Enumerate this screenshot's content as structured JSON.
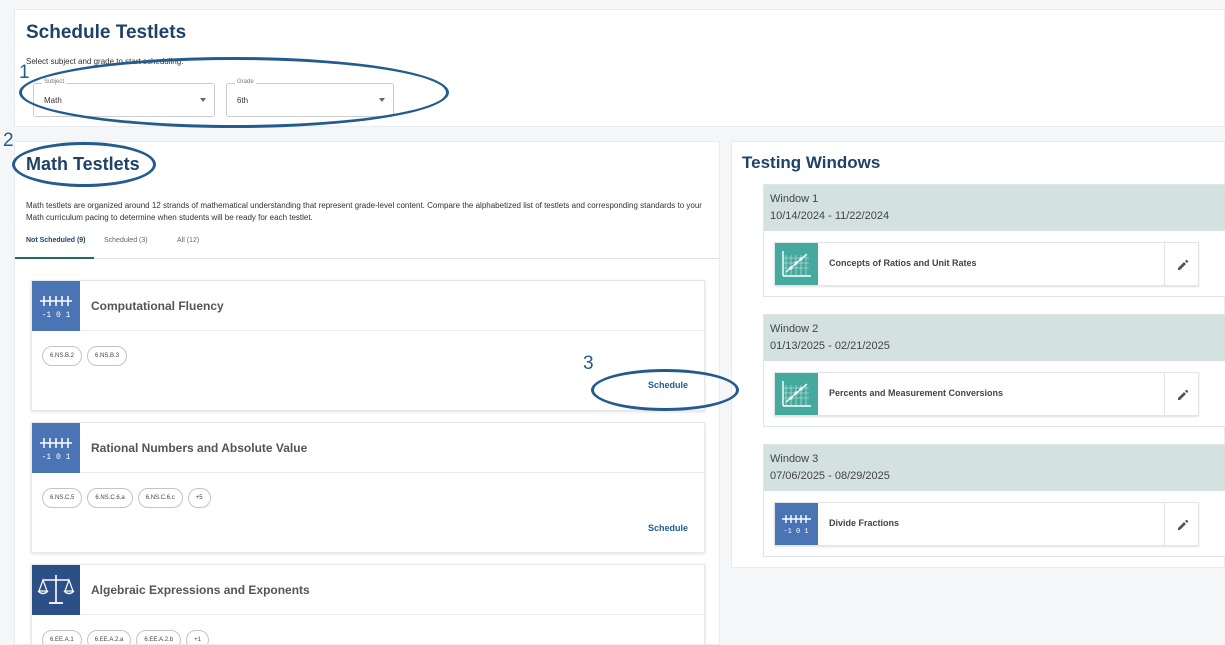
{
  "header": {
    "title": "Schedule Testlets",
    "instruction": "Select subject and grade to start scheduling."
  },
  "filters": {
    "subject": {
      "label": "Subject",
      "value": "Math"
    },
    "grade": {
      "label": "Grade",
      "value": "6th"
    }
  },
  "testlets_section": {
    "title": "Math Testlets",
    "description": "Math testlets are organized around 12 strands of mathematical understanding that represent grade-level content. Compare the alphabetized list of testlets and corresponding standards to your Math curriculum pacing to determine when students will be ready for each testlet.",
    "tabs": [
      {
        "label": "Not Scheduled (9)",
        "active": true
      },
      {
        "label": "Scheduled (3)",
        "active": false
      },
      {
        "label": "All (12)",
        "active": false
      }
    ],
    "schedule_label": "Schedule",
    "cards": [
      {
        "title": "Computational Fluency",
        "icon": "number-line-icon",
        "standards": [
          "6.NS.B.2",
          "6.NS.B.3"
        ]
      },
      {
        "title": "Rational Numbers and Absolute Value",
        "icon": "number-line-icon",
        "standards": [
          "6.NS.C.5",
          "6.NS.C.6.a",
          "6.NS.C.6.c",
          "+5"
        ]
      },
      {
        "title": "Algebraic Expressions and Exponents",
        "icon": "balance-scale-icon",
        "standards": [
          "6.EE.A.1",
          "6.EE.A.2.a",
          "6.EE.A.2.b",
          "+1"
        ]
      }
    ],
    "icon_number_line_text": "-1 0 1"
  },
  "testing_windows": {
    "title": "Testing Windows",
    "windows": [
      {
        "name": "Window 1",
        "dates": "10/14/2024 - 11/22/2024",
        "testlet": "Concepts of Ratios and Unit Rates",
        "icon": "graph-icon"
      },
      {
        "name": "Window 2",
        "dates": "01/13/2025 - 02/21/2025",
        "testlet": "Percents and Measurement Conversions",
        "icon": "graph-icon"
      },
      {
        "name": "Window 3",
        "dates": "07/06/2025 - 08/29/2025",
        "testlet": "Divide Fractions",
        "icon": "number-line-icon"
      }
    ]
  },
  "annotations": {
    "one": "1",
    "two": "2",
    "three": "3"
  },
  "colors": {
    "primary_navy": "#1f4266",
    "link_blue": "#1f5c93",
    "teal_icon": "#46a99d",
    "blue_icon": "#4a74b3",
    "window_header": "#d3e1e0"
  }
}
